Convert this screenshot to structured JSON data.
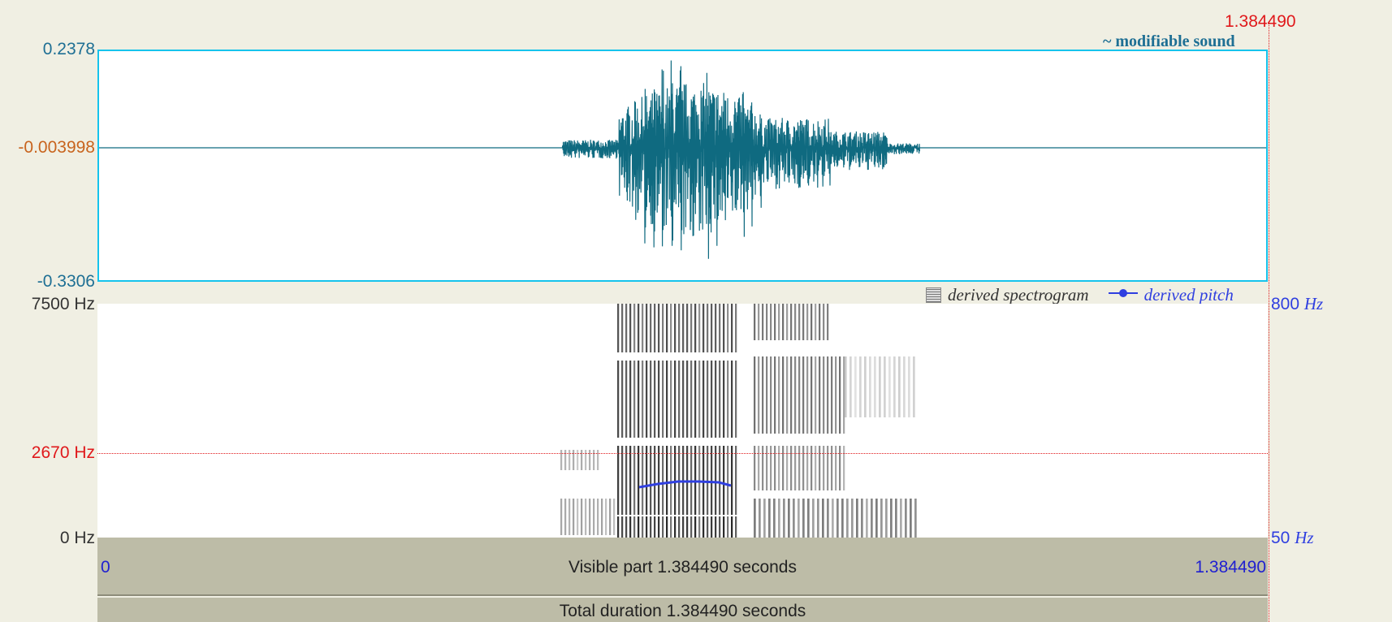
{
  "cursor": {
    "time": "1.384490"
  },
  "sound": {
    "title": "~ modifiable sound",
    "y_max": "0.2378",
    "y_center": "-0.003998",
    "y_min": "-0.3306"
  },
  "spectrogram": {
    "legend_spectrogram": "derived spectrogram",
    "legend_pitch": "derived pitch",
    "freq_top": "7500 Hz",
    "freq_cursor": "2670 Hz",
    "freq_bottom": "0 Hz",
    "pitch_top": "800 Hz",
    "pitch_top_num": "800",
    "pitch_top_unit": "Hz",
    "pitch_bottom_num": "50",
    "pitch_bottom_unit": "Hz"
  },
  "bars": {
    "start": "0",
    "end": "1.384490",
    "visible": "Visible part 1.384490 seconds",
    "total": "Total duration 1.384490 seconds"
  },
  "colors": {
    "waveform": "#0f6a80",
    "panel_border": "#16c3ec",
    "cursor": "#e0181b",
    "pitch": "#2f3fe0",
    "background": "#f0efe3",
    "bar": "#bdbca7"
  }
}
